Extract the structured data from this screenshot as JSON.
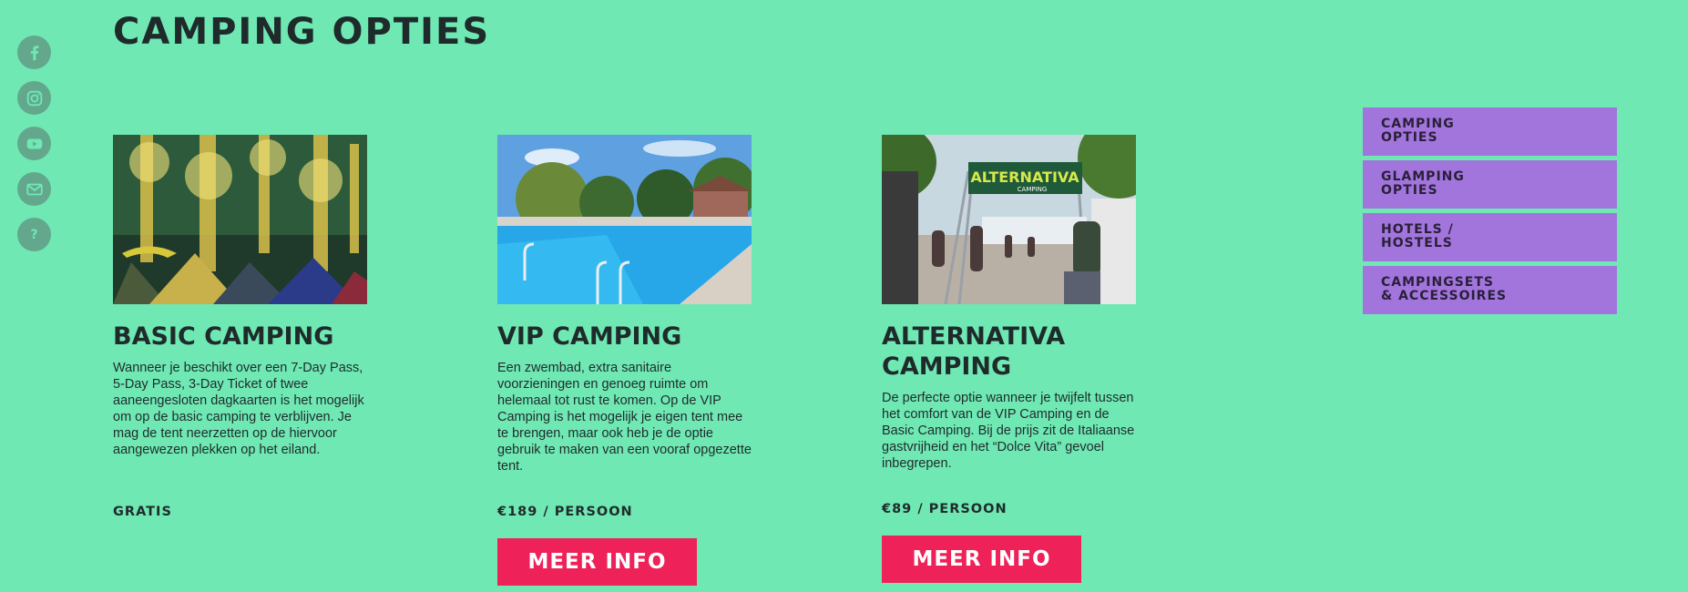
{
  "social": [
    {
      "icon": "facebook-icon"
    },
    {
      "icon": "instagram-icon"
    },
    {
      "icon": "youtube-icon"
    },
    {
      "icon": "mail-icon"
    },
    {
      "icon": "help-icon",
      "glyph": "?"
    }
  ],
  "page": {
    "title": "CAMPING OPTIES"
  },
  "cards": [
    {
      "title": "BASIC CAMPING",
      "description": "Wanneer je beschikt over een 7-Day Pass, 5-Day Pass, 3-Day Ticket of twee aaneengesloten dagkaarten is het mogelijk om op de basic camping te verblijven. Je mag de tent neerzetten op de hiervoor aangewezen plekken op het eiland.",
      "price": "GRATIS"
    },
    {
      "title": "VIP CAMPING",
      "description": "Een zwembad, extra sanitaire voorzieningen en genoeg ruimte om helemaal tot rust te komen. Op de VIP Camping is het mogelijk je eigen tent mee te brengen, maar ook heb je de optie gebruik te maken van een vooraf opgezette tent.",
      "price": "€189 / PERSOON",
      "button": "MEER INFO"
    },
    {
      "title": "ALTERNATIVA CAMPING",
      "description": "De perfecte optie wanneer je twijfelt tussen het comfort van de VIP Camping en de Basic Camping. Bij de prijs zit de Italiaanse gastvrijheid en het “Dolce Vita” gevoel inbegrepen.",
      "price": "€89 / PERSOON",
      "button": "MEER INFO",
      "sign_text": "ALTERNATIVA",
      "sign_sub": "CAMPING"
    }
  ],
  "side_menu": [
    {
      "label": "CAMPING\nOPTIES"
    },
    {
      "label": "GLAMPING\nOPTIES"
    },
    {
      "label": "HOTELS /\nHOSTELS"
    },
    {
      "label": "CAMPINGSETS\n& ACCESSOIRES"
    }
  ]
}
